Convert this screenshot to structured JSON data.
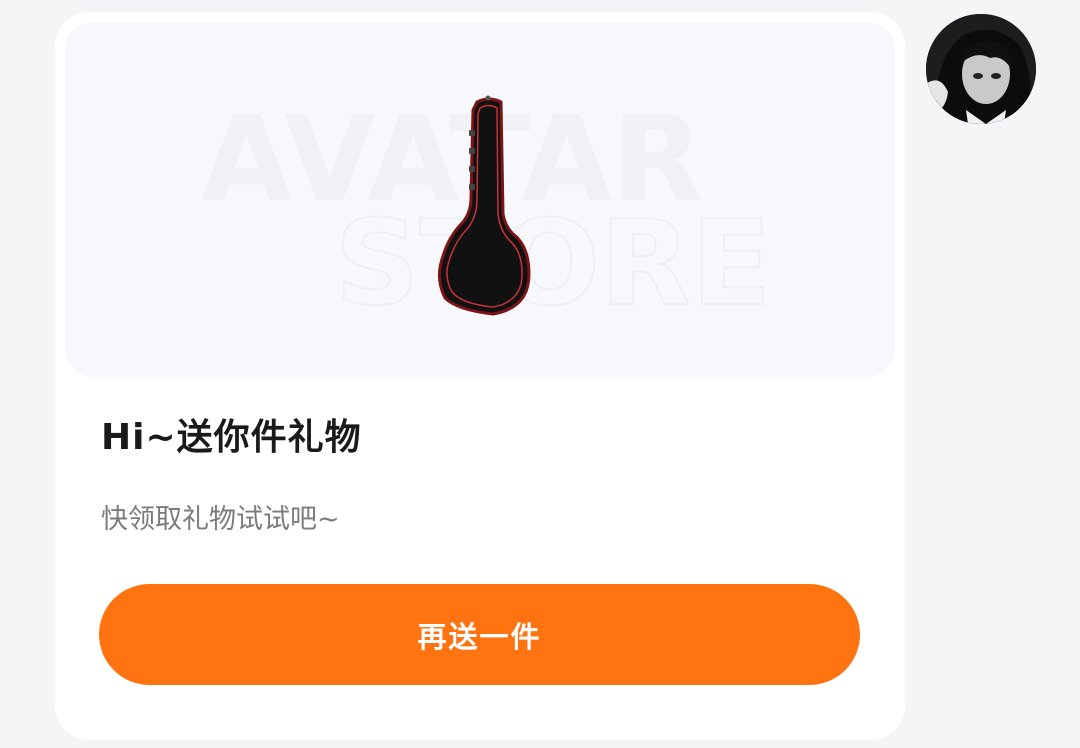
{
  "gift_card": {
    "watermark_line1": "AVATAR",
    "watermark_line2": "STORE",
    "gift_image_icon": "guitar-case-icon",
    "title": "Hi~送你件礼物",
    "subtitle": "快领取礼物试试吧~",
    "button_label": "再送一件",
    "button_color": "#ff7410"
  },
  "sender": {
    "avatar_icon": "user-avatar"
  }
}
